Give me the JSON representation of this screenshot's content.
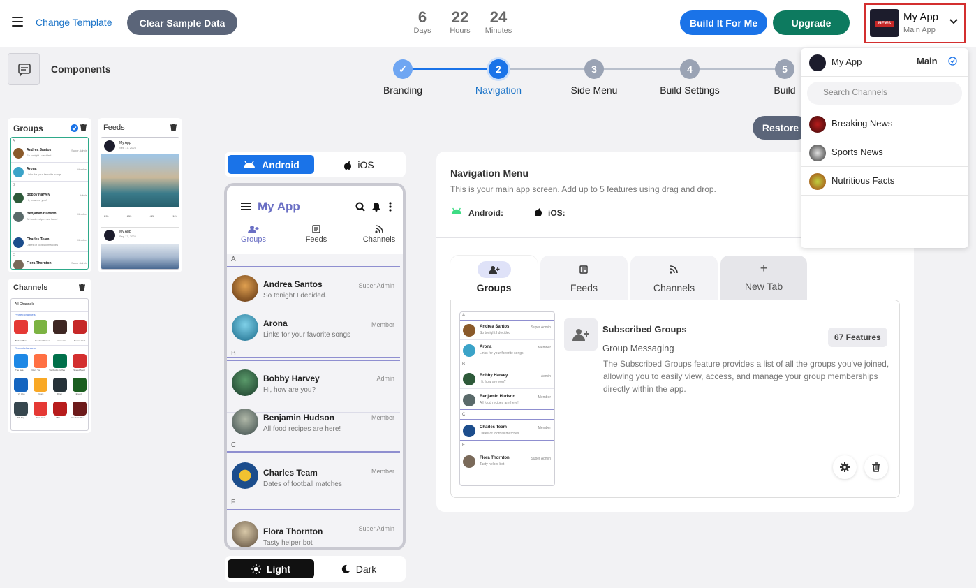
{
  "topbar": {
    "change_template": "Change Template",
    "clear_sample": "Clear Sample Data",
    "countdown": [
      {
        "value": "6",
        "unit": "Days"
      },
      {
        "value": "22",
        "unit": "Hours"
      },
      {
        "value": "24",
        "unit": "Minutes"
      }
    ],
    "build_for_me": "Build It For Me",
    "upgrade": "Upgrade",
    "app_name": "My App",
    "app_sub": "Main App",
    "app_logo_text": "NEWS"
  },
  "components_label": "Components",
  "stepper": [
    {
      "num": "✓",
      "label": "Branding",
      "state": "done"
    },
    {
      "num": "2",
      "label": "Navigation",
      "state": "active"
    },
    {
      "num": "3",
      "label": "Side Menu",
      "state": "todo"
    },
    {
      "num": "4",
      "label": "Build Settings",
      "state": "todo"
    },
    {
      "num": "5",
      "label": "Build",
      "state": "todo"
    }
  ],
  "restore": "Restore",
  "component_cards": {
    "groups_title": "Groups",
    "feeds_title": "Feeds",
    "channels_title": "Channels",
    "mini_groups": [
      {
        "name": "Andrea Santos",
        "sub": "So tonight I decided",
        "role": "Super Admin"
      },
      {
        "name": "Arona",
        "sub": "Links for your favorite songs",
        "role": "Member"
      },
      {
        "name": "Bobby Harvey",
        "sub": "Hi, how are you?",
        "role": "Admin"
      },
      {
        "name": "Benjamin Hudson",
        "sub": "All food recipes are here!",
        "role": "Member"
      },
      {
        "name": "Charles Team",
        "sub": "Dates of football matches",
        "role": "Member"
      },
      {
        "name": "Flora Thornton",
        "sub": "Tasty helper bot",
        "role": "Super Admin"
      }
    ],
    "feed_app": "My App",
    "feed_date": "Sep 17, 2025",
    "feed_stats": [
      "29k",
      "853",
      "42k",
      "124"
    ],
    "channels_all": "All Channels",
    "channels_pinned": "Pinned channels",
    "channels_recent": "Recent channels",
    "pinned_channels": [
      "Bibbo's Baro",
      "Foodie's Dinner",
      "Genesite",
      "Soccer Club"
    ],
    "recent_channels_a": [
      "The Sea",
      "Rock You",
      "Starbucks Coffee",
      "Speed Sport"
    ],
    "recent_channels_b": [
      "VJ Live",
      "Giant",
      "Diner",
      "Energy"
    ],
    "recent_channels_c": [
      "BW Kay",
      "Pizza Hut",
      "ABC",
      "Crede Coffee"
    ]
  },
  "phone": {
    "platforms": [
      "Android",
      "iOS"
    ],
    "app_title": "My App",
    "tabs": [
      "Groups",
      "Feeds",
      "Channels"
    ],
    "sections": [
      "A",
      "B",
      "C",
      "F"
    ],
    "rows": [
      {
        "name": "Andrea Santos",
        "sub": "So tonight I decided.",
        "role": "Super Admin"
      },
      {
        "name": "Arona",
        "sub": "Links for your favorite songs",
        "role": "Member"
      },
      {
        "name": "Bobby Harvey",
        "sub": "Hi, how are you?",
        "role": "Admin"
      },
      {
        "name": "Benjamin Hudson",
        "sub": "All food recipes are here!",
        "role": "Member"
      },
      {
        "name": "Charles Team",
        "sub": "Dates of football matches",
        "role": "Member"
      },
      {
        "name": "Flora Thornton",
        "sub": "Tasty helper bot",
        "role": "Super Admin"
      }
    ],
    "themes": [
      "Light",
      "Dark"
    ]
  },
  "nav_menu": {
    "title": "Navigation Menu",
    "desc": "This is your main app screen. Add up to 5 features using drag and drop.",
    "android_label": "Android:",
    "ios_label": "iOS:",
    "tabs": [
      "Groups",
      "Feeds",
      "Channels",
      "New Tab"
    ],
    "feature": {
      "title": "Subscribed Groups",
      "badge": "67 Features",
      "subtitle": "Group Messaging",
      "desc": "The Subscribed Groups feature provides a list of all the groups you've joined, allowing you to easily view, access, and manage your group memberships directly within the app."
    }
  },
  "dropdown": {
    "app": "My App",
    "main": "Main",
    "search_placeholder": "Search Channels",
    "items": [
      "Breaking News",
      "Sports News",
      "Nutritious Facts"
    ]
  },
  "colors": {
    "accent": "#1a73e8",
    "upgrade": "#0d7a5f",
    "dark_pill": "#5b6579",
    "highlight": "#d32f2f"
  }
}
